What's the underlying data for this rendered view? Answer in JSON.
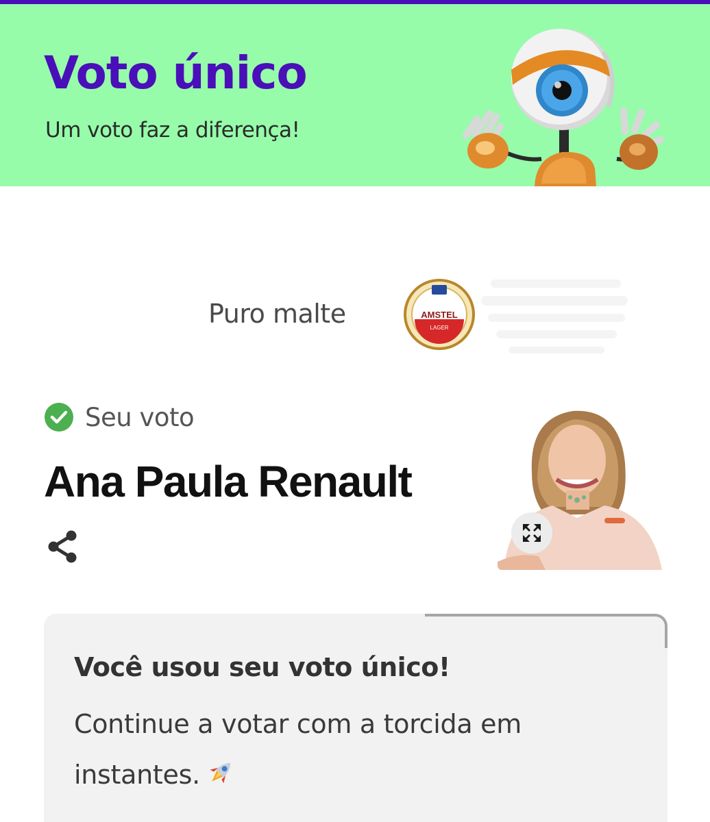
{
  "header": {
    "title": "Voto único",
    "subtitle": "Um voto faz a diferença!",
    "mascot_icon": "big-brother-eye-mascot",
    "background_color": "#96fcaa",
    "accent_color": "#4a0fb8"
  },
  "sponsor": {
    "text": "Puro malte",
    "logo_icon": "amstel-logo",
    "logo_text": "AMSTEL",
    "logo_subtext": "LAGER"
  },
  "vote": {
    "status_label": "Seu voto",
    "status_icon": "check-circle",
    "status_color": "#4caf50",
    "candidate_name": "Ana Paula Renault",
    "share_icon": "share-icon",
    "expand_icon": "expand-icon"
  },
  "notice": {
    "title": "Você usou seu voto único!",
    "body": "Continue a votar com a torcida em instantes.",
    "emoji_icon": "rocket-icon"
  }
}
